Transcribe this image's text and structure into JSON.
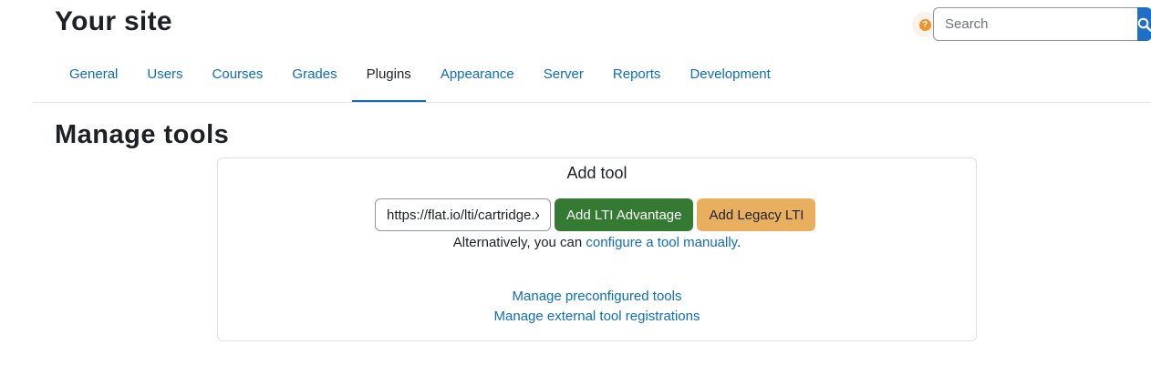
{
  "header": {
    "site_title": "Your site",
    "help_icon": "question-circle-icon",
    "search": {
      "placeholder": "Search",
      "value": "",
      "button_icon": "search-icon"
    }
  },
  "nav": {
    "tabs": [
      {
        "label": "General",
        "active": false
      },
      {
        "label": "Users",
        "active": false
      },
      {
        "label": "Courses",
        "active": false
      },
      {
        "label": "Grades",
        "active": false
      },
      {
        "label": "Plugins",
        "active": true
      },
      {
        "label": "Appearance",
        "active": false
      },
      {
        "label": "Server",
        "active": false
      },
      {
        "label": "Reports",
        "active": false
      },
      {
        "label": "Development",
        "active": false
      }
    ]
  },
  "main": {
    "heading": "Manage tools",
    "add_tool": {
      "title": "Add tool",
      "url_value": "https://flat.io/lti/cartridge.xml",
      "lti_advantage_label": "Add LTI Advantage",
      "legacy_lti_label": "Add Legacy LTI",
      "alt_prefix": "Alternatively, you can ",
      "alt_link": "configure a tool manually",
      "alt_suffix": ".",
      "links": [
        "Manage preconfigured tools",
        "Manage external tool registrations"
      ]
    }
  },
  "colors": {
    "link": "#0f6cbf",
    "primary": "#1f6fc5",
    "success": "#357a32",
    "warning": "#e8b05e",
    "help": "#f0932b"
  }
}
